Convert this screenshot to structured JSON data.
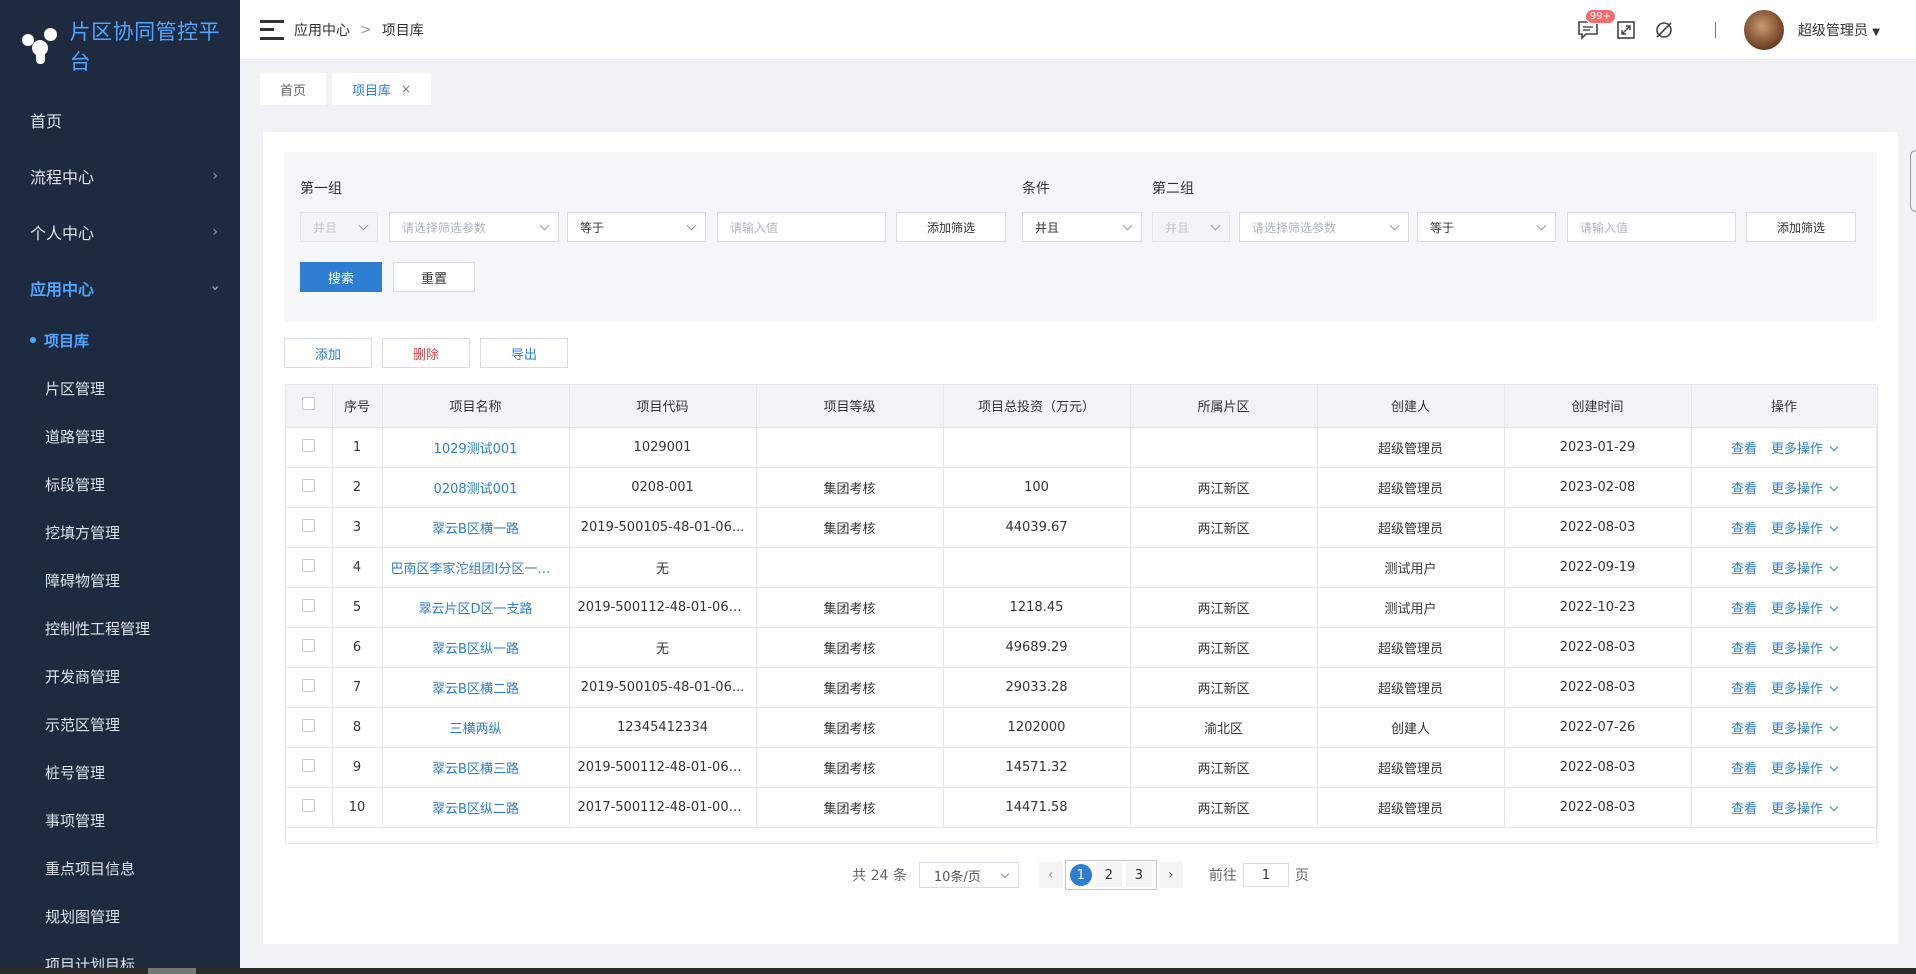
{
  "app": {
    "title": "片区协同管控平台"
  },
  "sidebar": {
    "items": [
      {
        "label": "首页"
      },
      {
        "label": "流程中心"
      },
      {
        "label": "个人中心"
      },
      {
        "label": "应用中心"
      }
    ],
    "sub_items": [
      {
        "label": "项目库"
      },
      {
        "label": "片区管理"
      },
      {
        "label": "道路管理"
      },
      {
        "label": "标段管理"
      },
      {
        "label": "挖填方管理"
      },
      {
        "label": "障碍物管理"
      },
      {
        "label": "控制性工程管理"
      },
      {
        "label": "开发商管理"
      },
      {
        "label": "示范区管理"
      },
      {
        "label": "桩号管理"
      },
      {
        "label": "事项管理"
      },
      {
        "label": "重点项目信息"
      },
      {
        "label": "规划图管理"
      },
      {
        "label": "项目计划目标"
      }
    ]
  },
  "header": {
    "breadcrumb": [
      "应用中心",
      "项目库"
    ],
    "breadcrumb_sep": ">",
    "message_badge": "99+",
    "user_name": "超级管理员"
  },
  "tabs": [
    {
      "label": "首页"
    },
    {
      "label": "项目库",
      "close": "×"
    }
  ],
  "filter": {
    "group1_label": "第一组",
    "condition_label": "条件",
    "group2_label": "第二组",
    "g1_logic": "并且",
    "g1_param_placeholder": "请选择筛选参数",
    "g1_operator": "等于",
    "g1_value_placeholder": "请输入值",
    "g1_add": "添加筛选",
    "condition_value": "并且",
    "g2_logic": "并且",
    "g2_param_placeholder": "请选择筛选参数",
    "g2_operator": "等于",
    "g2_value_placeholder": "请输入值",
    "g2_add": "添加筛选",
    "search_label": "搜索",
    "reset_label": "重置"
  },
  "actions": {
    "add": "添加",
    "delete": "删除",
    "export": "导出"
  },
  "table": {
    "headers": [
      "序号",
      "项目名称",
      "项目代码",
      "项目等级",
      "项目总投资（万元）",
      "所属片区",
      "创建人",
      "创建时间",
      "操作"
    ],
    "view_label": "查看",
    "more_label": "更多操作",
    "rows": [
      {
        "no": "1",
        "name": "1029测试001",
        "code": "1029001",
        "level": "",
        "invest": "",
        "area": "",
        "creator": "超级管理员",
        "time": "2023-01-29"
      },
      {
        "no": "2",
        "name": "0208测试001",
        "code": "0208-001",
        "level": "集团考核",
        "invest": "100",
        "area": "两江新区",
        "creator": "超级管理员",
        "time": "2023-02-08"
      },
      {
        "no": "3",
        "name": "翠云B区横一路",
        "code": "2019-500105-48-01-06...",
        "level": "集团考核",
        "invest": "44039.67",
        "area": "两江新区",
        "creator": "超级管理员",
        "time": "2022-08-03"
      },
      {
        "no": "4",
        "name": "巴南区李家沱组团I分区一标段",
        "code": "无",
        "level": "",
        "invest": "",
        "area": "",
        "creator": "测试用户",
        "time": "2022-09-19"
      },
      {
        "no": "5",
        "name": "翠云片区D区一支路",
        "code": "2019-500112-48-01-065...",
        "level": "集团考核",
        "invest": "1218.45",
        "area": "两江新区",
        "creator": "测试用户",
        "time": "2022-10-23"
      },
      {
        "no": "6",
        "name": "翠云B区纵一路",
        "code": "无",
        "level": "集团考核",
        "invest": "49689.29",
        "area": "两江新区",
        "creator": "超级管理员",
        "time": "2022-08-03"
      },
      {
        "no": "7",
        "name": "翠云B区横二路",
        "code": "2019-500105-48-01-06...",
        "level": "集团考核",
        "invest": "29033.28",
        "area": "两江新区",
        "creator": "超级管理员",
        "time": "2022-08-03"
      },
      {
        "no": "8",
        "name": "三横两纵",
        "code": "12345412334",
        "level": "集团考核",
        "invest": "1202000",
        "area": "渝北区",
        "creator": "创建人",
        "time": "2022-07-26"
      },
      {
        "no": "9",
        "name": "翠云B区横三路",
        "code": "2019-500112-48-01-065...",
        "level": "集团考核",
        "invest": "14571.32",
        "area": "两江新区",
        "creator": "超级管理员",
        "time": "2022-08-03"
      },
      {
        "no": "10",
        "name": "翠云B区纵二路",
        "code": "2017-500112-48-01-000...",
        "level": "集团考核",
        "invest": "14471.58",
        "area": "两江新区",
        "creator": "超级管理员",
        "time": "2022-08-03"
      }
    ]
  },
  "pagination": {
    "total": "共 24 条",
    "page_size": "10条/页",
    "prev": "‹",
    "next": "›",
    "pages": [
      "1",
      "2",
      "3"
    ],
    "current_page": "1",
    "goto_prefix": "前往",
    "goto_value": "1",
    "goto_suffix": "页"
  }
}
